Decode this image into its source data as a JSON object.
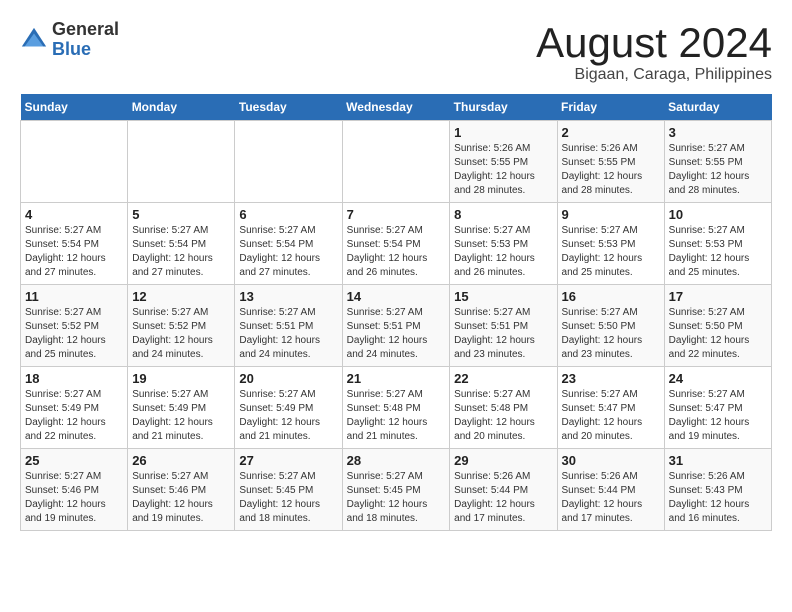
{
  "logo": {
    "general": "General",
    "blue": "Blue"
  },
  "title": {
    "month": "August 2024",
    "location": "Bigaan, Caraga, Philippines"
  },
  "weekdays": [
    "Sunday",
    "Monday",
    "Tuesday",
    "Wednesday",
    "Thursday",
    "Friday",
    "Saturday"
  ],
  "weeks": [
    [
      {
        "day": "",
        "info": ""
      },
      {
        "day": "",
        "info": ""
      },
      {
        "day": "",
        "info": ""
      },
      {
        "day": "",
        "info": ""
      },
      {
        "day": "1",
        "info": "Sunrise: 5:26 AM\nSunset: 5:55 PM\nDaylight: 12 hours\nand 28 minutes."
      },
      {
        "day": "2",
        "info": "Sunrise: 5:26 AM\nSunset: 5:55 PM\nDaylight: 12 hours\nand 28 minutes."
      },
      {
        "day": "3",
        "info": "Sunrise: 5:27 AM\nSunset: 5:55 PM\nDaylight: 12 hours\nand 28 minutes."
      }
    ],
    [
      {
        "day": "4",
        "info": "Sunrise: 5:27 AM\nSunset: 5:54 PM\nDaylight: 12 hours\nand 27 minutes."
      },
      {
        "day": "5",
        "info": "Sunrise: 5:27 AM\nSunset: 5:54 PM\nDaylight: 12 hours\nand 27 minutes."
      },
      {
        "day": "6",
        "info": "Sunrise: 5:27 AM\nSunset: 5:54 PM\nDaylight: 12 hours\nand 27 minutes."
      },
      {
        "day": "7",
        "info": "Sunrise: 5:27 AM\nSunset: 5:54 PM\nDaylight: 12 hours\nand 26 minutes."
      },
      {
        "day": "8",
        "info": "Sunrise: 5:27 AM\nSunset: 5:53 PM\nDaylight: 12 hours\nand 26 minutes."
      },
      {
        "day": "9",
        "info": "Sunrise: 5:27 AM\nSunset: 5:53 PM\nDaylight: 12 hours\nand 25 minutes."
      },
      {
        "day": "10",
        "info": "Sunrise: 5:27 AM\nSunset: 5:53 PM\nDaylight: 12 hours\nand 25 minutes."
      }
    ],
    [
      {
        "day": "11",
        "info": "Sunrise: 5:27 AM\nSunset: 5:52 PM\nDaylight: 12 hours\nand 25 minutes."
      },
      {
        "day": "12",
        "info": "Sunrise: 5:27 AM\nSunset: 5:52 PM\nDaylight: 12 hours\nand 24 minutes."
      },
      {
        "day": "13",
        "info": "Sunrise: 5:27 AM\nSunset: 5:51 PM\nDaylight: 12 hours\nand 24 minutes."
      },
      {
        "day": "14",
        "info": "Sunrise: 5:27 AM\nSunset: 5:51 PM\nDaylight: 12 hours\nand 24 minutes."
      },
      {
        "day": "15",
        "info": "Sunrise: 5:27 AM\nSunset: 5:51 PM\nDaylight: 12 hours\nand 23 minutes."
      },
      {
        "day": "16",
        "info": "Sunrise: 5:27 AM\nSunset: 5:50 PM\nDaylight: 12 hours\nand 23 minutes."
      },
      {
        "day": "17",
        "info": "Sunrise: 5:27 AM\nSunset: 5:50 PM\nDaylight: 12 hours\nand 22 minutes."
      }
    ],
    [
      {
        "day": "18",
        "info": "Sunrise: 5:27 AM\nSunset: 5:49 PM\nDaylight: 12 hours\nand 22 minutes."
      },
      {
        "day": "19",
        "info": "Sunrise: 5:27 AM\nSunset: 5:49 PM\nDaylight: 12 hours\nand 21 minutes."
      },
      {
        "day": "20",
        "info": "Sunrise: 5:27 AM\nSunset: 5:49 PM\nDaylight: 12 hours\nand 21 minutes."
      },
      {
        "day": "21",
        "info": "Sunrise: 5:27 AM\nSunset: 5:48 PM\nDaylight: 12 hours\nand 21 minutes."
      },
      {
        "day": "22",
        "info": "Sunrise: 5:27 AM\nSunset: 5:48 PM\nDaylight: 12 hours\nand 20 minutes."
      },
      {
        "day": "23",
        "info": "Sunrise: 5:27 AM\nSunset: 5:47 PM\nDaylight: 12 hours\nand 20 minutes."
      },
      {
        "day": "24",
        "info": "Sunrise: 5:27 AM\nSunset: 5:47 PM\nDaylight: 12 hours\nand 19 minutes."
      }
    ],
    [
      {
        "day": "25",
        "info": "Sunrise: 5:27 AM\nSunset: 5:46 PM\nDaylight: 12 hours\nand 19 minutes."
      },
      {
        "day": "26",
        "info": "Sunrise: 5:27 AM\nSunset: 5:46 PM\nDaylight: 12 hours\nand 19 minutes."
      },
      {
        "day": "27",
        "info": "Sunrise: 5:27 AM\nSunset: 5:45 PM\nDaylight: 12 hours\nand 18 minutes."
      },
      {
        "day": "28",
        "info": "Sunrise: 5:27 AM\nSunset: 5:45 PM\nDaylight: 12 hours\nand 18 minutes."
      },
      {
        "day": "29",
        "info": "Sunrise: 5:26 AM\nSunset: 5:44 PM\nDaylight: 12 hours\nand 17 minutes."
      },
      {
        "day": "30",
        "info": "Sunrise: 5:26 AM\nSunset: 5:44 PM\nDaylight: 12 hours\nand 17 minutes."
      },
      {
        "day": "31",
        "info": "Sunrise: 5:26 AM\nSunset: 5:43 PM\nDaylight: 12 hours\nand 16 minutes."
      }
    ]
  ]
}
